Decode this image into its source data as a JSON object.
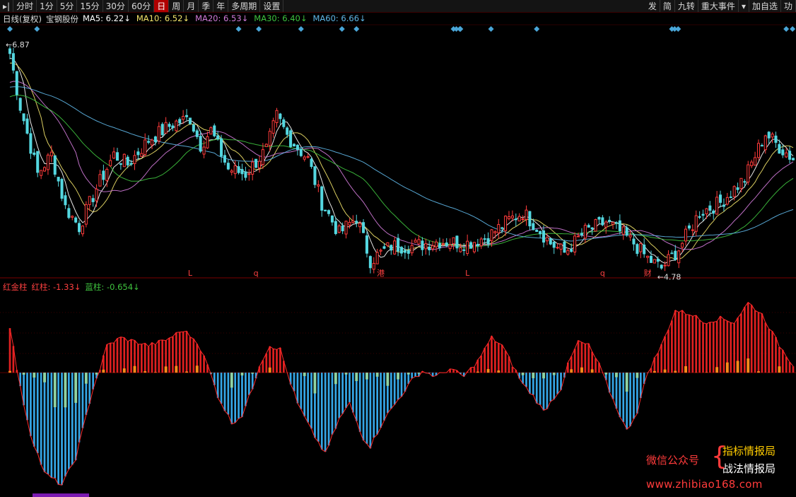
{
  "toolbar": {
    "left_items": [
      "▸|",
      "分时",
      "1分",
      "5分",
      "15分",
      "30分",
      "60分",
      "日",
      "周",
      "月",
      "季",
      "年",
      "多周期",
      "设置"
    ],
    "active_label": "日",
    "right_items": [
      "发",
      "简",
      "九转",
      "重大事件",
      "▾",
      "加自选",
      "功"
    ]
  },
  "kline_info": {
    "period_label": "日线(复权)",
    "stock_name": "宝钢股份",
    "ma": [
      {
        "label": "MA5: 6.22↓",
        "color": "#ffffff"
      },
      {
        "label": "MA10: 6.52↓",
        "color": "#f2e36a"
      },
      {
        "label": "MA20: 6.53↓",
        "color": "#d07ad8"
      },
      {
        "label": "MA30: 6.40↓",
        "color": "#3fc43f"
      },
      {
        "label": "MA60: 6.66↓",
        "color": "#5fb7e8"
      }
    ]
  },
  "annotations": {
    "high_label": "6.87",
    "low_label": "4.78",
    "markers": [
      {
        "text": "L",
        "x_index": 52
      },
      {
        "text": "q",
        "x_index": 71
      },
      {
        "text": "港",
        "x_index": 107
      },
      {
        "text": "L",
        "x_index": 132
      },
      {
        "text": "q",
        "x_index": 171
      },
      {
        "text": "财",
        "x_index": 184
      }
    ]
  },
  "indicator_info": {
    "name": "红金柱",
    "red_label": "红柱: -1.33↓",
    "blue_label": "蓝柱: -0.654↓",
    "name_color": "#ff4040",
    "red_color": "#ff4040",
    "blue_color": "#3fc43f"
  },
  "watermark": {
    "wechat": "微信公众号",
    "brace": "{",
    "line_a": "指标情报局",
    "line_b": "战法情报局",
    "url": "www.zhibiao168.com"
  },
  "colors": {
    "up": "#ff3b3b",
    "down": "#54d7e0",
    "ind_red": "#e02020",
    "ind_orange": "#ff8a1a",
    "ind_blue": "#35a6e6",
    "ind_green": "#8fd3a3",
    "diamond": "#4aa6d8"
  },
  "chart_data": {
    "type": "candlestick",
    "ma_periods": [
      5,
      10,
      20,
      30,
      60
    ],
    "price_range": [
      4.6,
      6.95
    ],
    "close_anchors": [
      [
        0,
        6.85
      ],
      [
        3,
        6.3
      ],
      [
        8,
        5.6
      ],
      [
        12,
        5.8
      ],
      [
        16,
        5.25
      ],
      [
        20,
        5.05
      ],
      [
        25,
        5.45
      ],
      [
        30,
        5.8
      ],
      [
        34,
        5.7
      ],
      [
        40,
        5.95
      ],
      [
        47,
        6.12
      ],
      [
        52,
        6.18
      ],
      [
        55,
        5.9
      ],
      [
        58,
        6.05
      ],
      [
        63,
        5.65
      ],
      [
        68,
        5.6
      ],
      [
        74,
        5.85
      ],
      [
        77,
        6.2
      ],
      [
        80,
        6.0
      ],
      [
        86,
        5.75
      ],
      [
        90,
        5.3
      ],
      [
        95,
        4.98
      ],
      [
        100,
        5.15
      ],
      [
        104,
        4.7
      ],
      [
        110,
        4.85
      ],
      [
        116,
        4.85
      ],
      [
        124,
        4.9
      ],
      [
        132,
        4.88
      ],
      [
        138,
        4.95
      ],
      [
        144,
        5.12
      ],
      [
        148,
        5.2
      ],
      [
        152,
        5.05
      ],
      [
        156,
        4.88
      ],
      [
        160,
        4.78
      ],
      [
        166,
        5.0
      ],
      [
        172,
        5.1
      ],
      [
        176,
        5.0
      ],
      [
        180,
        4.88
      ],
      [
        184,
        4.72
      ],
      [
        188,
        4.62
      ],
      [
        193,
        4.82
      ],
      [
        199,
        5.2
      ],
      [
        205,
        5.3
      ],
      [
        212,
        5.55
      ],
      [
        218,
        6.02
      ],
      [
        222,
        5.88
      ],
      [
        226,
        5.76
      ]
    ],
    "ma_start_values": [
      6.8,
      6.75,
      6.55,
      6.4,
      6.5
    ],
    "indicator_range": [
      -1.55,
      1.05
    ],
    "indicator_anchors": [
      [
        0,
        0.6
      ],
      [
        2,
        0.05
      ],
      [
        3,
        -0.2
      ],
      [
        6,
        -0.8
      ],
      [
        10,
        -1.3
      ],
      [
        15,
        -1.45
      ],
      [
        19,
        -1.1
      ],
      [
        24,
        -0.2
      ],
      [
        26,
        0.05
      ],
      [
        28,
        0.35
      ],
      [
        32,
        0.45
      ],
      [
        36,
        0.4
      ],
      [
        40,
        0.35
      ],
      [
        45,
        0.42
      ],
      [
        50,
        0.55
      ],
      [
        54,
        0.4
      ],
      [
        57,
        0.1
      ],
      [
        60,
        -0.3
      ],
      [
        64,
        -0.65
      ],
      [
        67,
        -0.55
      ],
      [
        70,
        -0.2
      ],
      [
        72,
        0.1
      ],
      [
        75,
        0.35
      ],
      [
        78,
        0.3
      ],
      [
        80,
        0.0
      ],
      [
        83,
        -0.4
      ],
      [
        87,
        -0.75
      ],
      [
        91,
        -1.05
      ],
      [
        95,
        -0.6
      ],
      [
        98,
        -0.4
      ],
      [
        102,
        -0.85
      ],
      [
        104,
        -0.95
      ],
      [
        108,
        -0.6
      ],
      [
        112,
        -0.35
      ],
      [
        116,
        -0.1
      ],
      [
        119,
        0.02
      ],
      [
        123,
        -0.05
      ],
      [
        127,
        0.05
      ],
      [
        131,
        -0.05
      ],
      [
        135,
        0.15
      ],
      [
        139,
        0.45
      ],
      [
        142,
        0.35
      ],
      [
        145,
        0.1
      ],
      [
        148,
        -0.15
      ],
      [
        151,
        -0.3
      ],
      [
        154,
        -0.5
      ],
      [
        159,
        -0.2
      ],
      [
        161,
        0.1
      ],
      [
        164,
        0.4
      ],
      [
        167,
        0.35
      ],
      [
        170,
        0.1
      ],
      [
        174,
        -0.35
      ],
      [
        178,
        -0.75
      ],
      [
        181,
        -0.5
      ],
      [
        184,
        0.0
      ],
      [
        188,
        0.35
      ],
      [
        192,
        0.8
      ],
      [
        197,
        0.75
      ],
      [
        200,
        0.65
      ],
      [
        205,
        0.7
      ],
      [
        209,
        0.65
      ],
      [
        213,
        0.9
      ],
      [
        217,
        0.75
      ],
      [
        222,
        0.35
      ],
      [
        226,
        0.1
      ]
    ]
  }
}
